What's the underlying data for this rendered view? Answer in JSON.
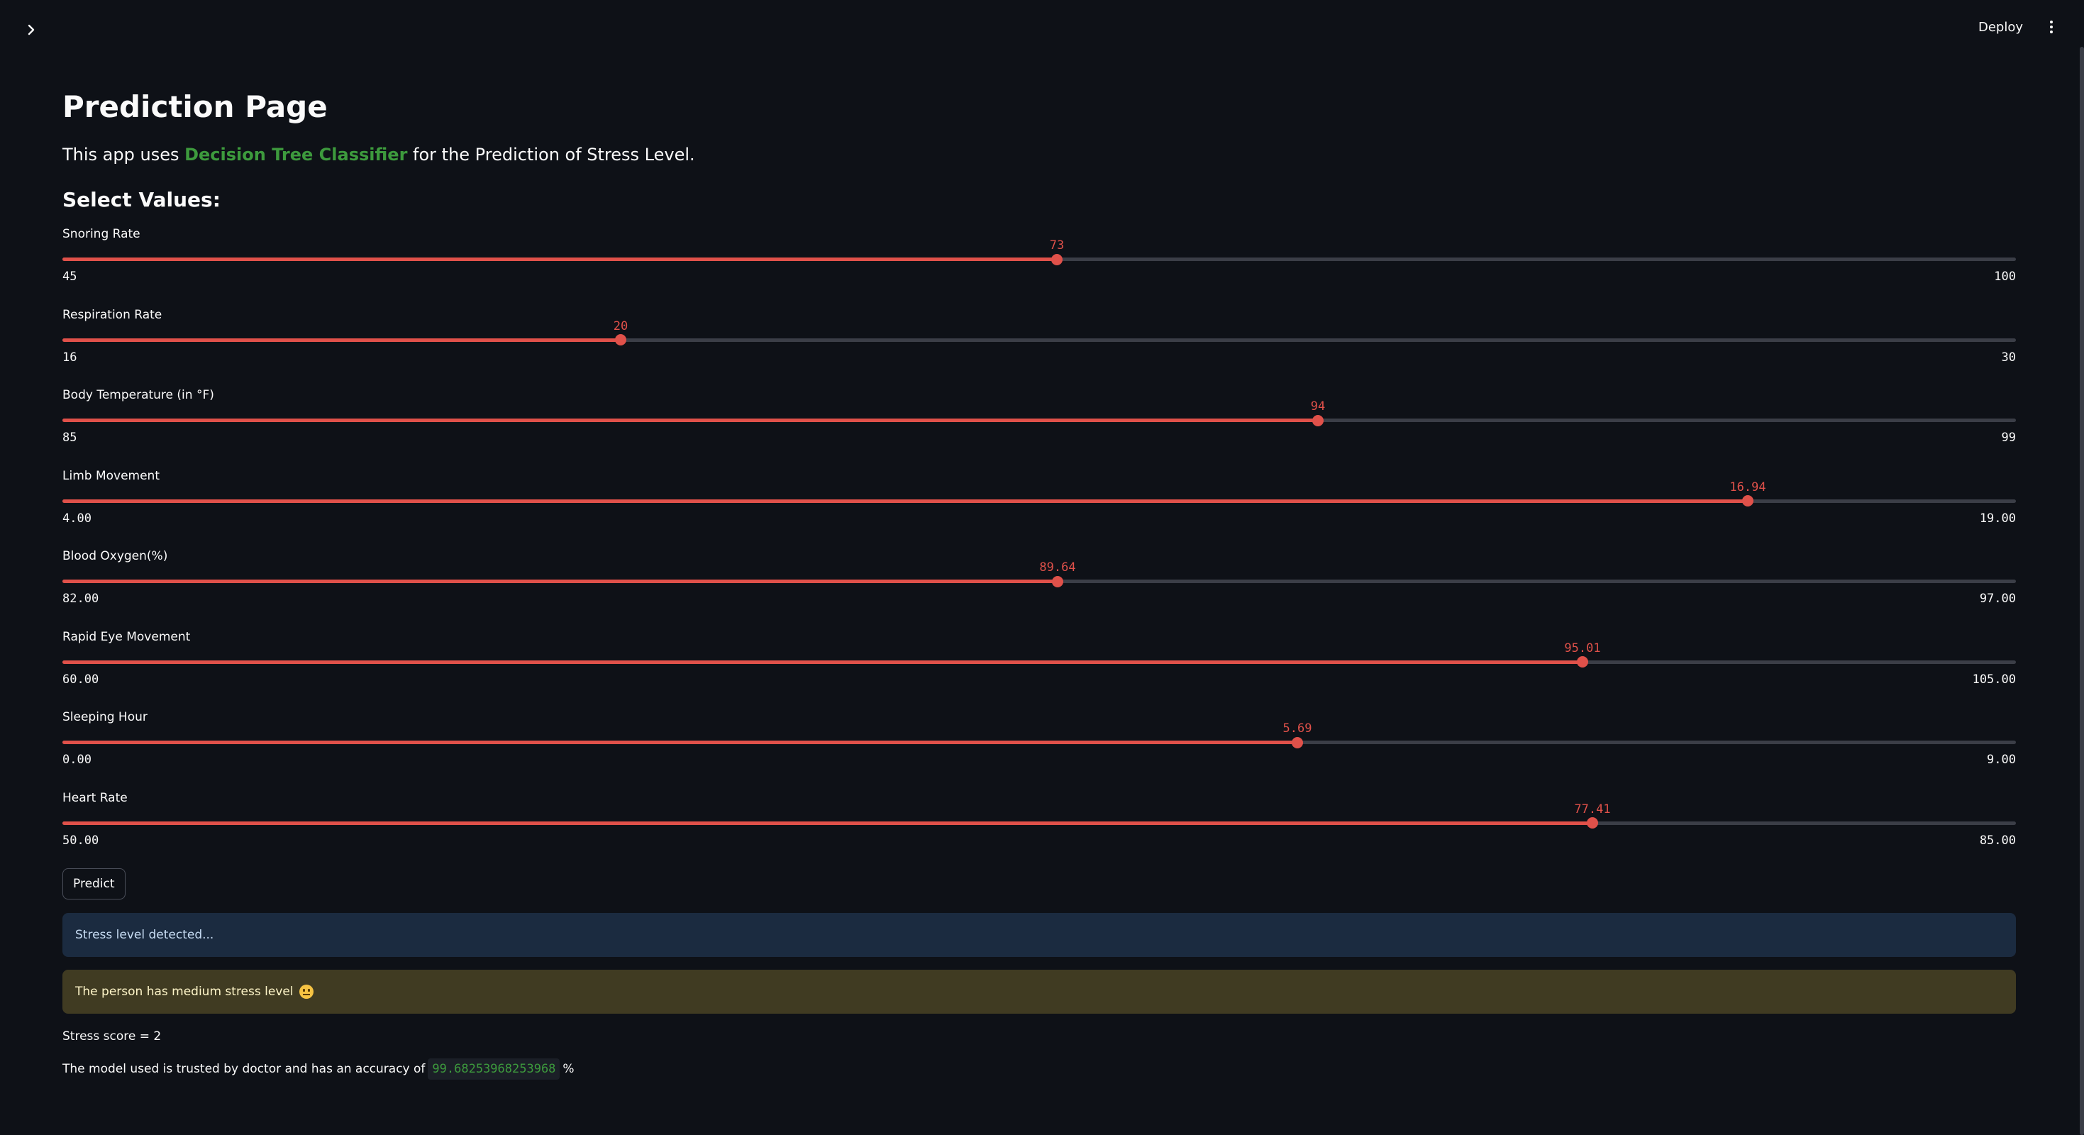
{
  "header": {
    "deploy_label": "Deploy",
    "sidebar_toggle_icon": "chevron-right-icon",
    "menu_icon": "vertical-dots-icon"
  },
  "main": {
    "title": "Prediction Page",
    "intro": {
      "before": "This app uses ",
      "highlight": "Decision Tree Classifier",
      "after": " for the Prediction of Stress Level."
    },
    "section_heading": "Select Values:"
  },
  "sliders": [
    {
      "label": "Snoring Rate",
      "min": 45,
      "max": 100,
      "value": 73,
      "min_label": "45",
      "max_label": "100",
      "value_label": "73"
    },
    {
      "label": "Respiration Rate",
      "min": 16,
      "max": 30,
      "value": 20,
      "min_label": "16",
      "max_label": "30",
      "value_label": "20"
    },
    {
      "label": "Body Temperature (in °F)",
      "min": 85,
      "max": 99,
      "value": 94,
      "min_label": "85",
      "max_label": "99",
      "value_label": "94"
    },
    {
      "label": "Limb Movement",
      "min": 4,
      "max": 19,
      "value": 16.94,
      "min_label": "4.00",
      "max_label": "19.00",
      "value_label": "16.94"
    },
    {
      "label": "Blood Oxygen(%)",
      "min": 82,
      "max": 97,
      "value": 89.64,
      "min_label": "82.00",
      "max_label": "97.00",
      "value_label": "89.64"
    },
    {
      "label": "Rapid Eye Movement",
      "min": 60,
      "max": 105,
      "value": 95.01,
      "min_label": "60.00",
      "max_label": "105.00",
      "value_label": "95.01"
    },
    {
      "label": "Sleeping Hour",
      "min": 0,
      "max": 9,
      "value": 5.69,
      "min_label": "0.00",
      "max_label": "9.00",
      "value_label": "5.69"
    },
    {
      "label": "Heart Rate",
      "min": 50,
      "max": 85,
      "value": 77.41,
      "min_label": "50.00",
      "max_label": "85.00",
      "value_label": "77.41"
    }
  ],
  "predict_label": "Predict",
  "results": {
    "info": "Stress level detected...",
    "warning": "The person has medium stress level",
    "warning_icon": "neutral-face-emoji",
    "score": "Stress score = 2",
    "accuracy_before": "The model used is trusted by doctor and has an accuracy of",
    "accuracy_value": "99.68253968253968",
    "accuracy_after": "%"
  },
  "colors": {
    "background": "#0e1117",
    "accent": "#e0514a",
    "highlight_green": "#3d9a3d",
    "info_bg": "#1b2b40",
    "warning_bg": "#403b22"
  }
}
